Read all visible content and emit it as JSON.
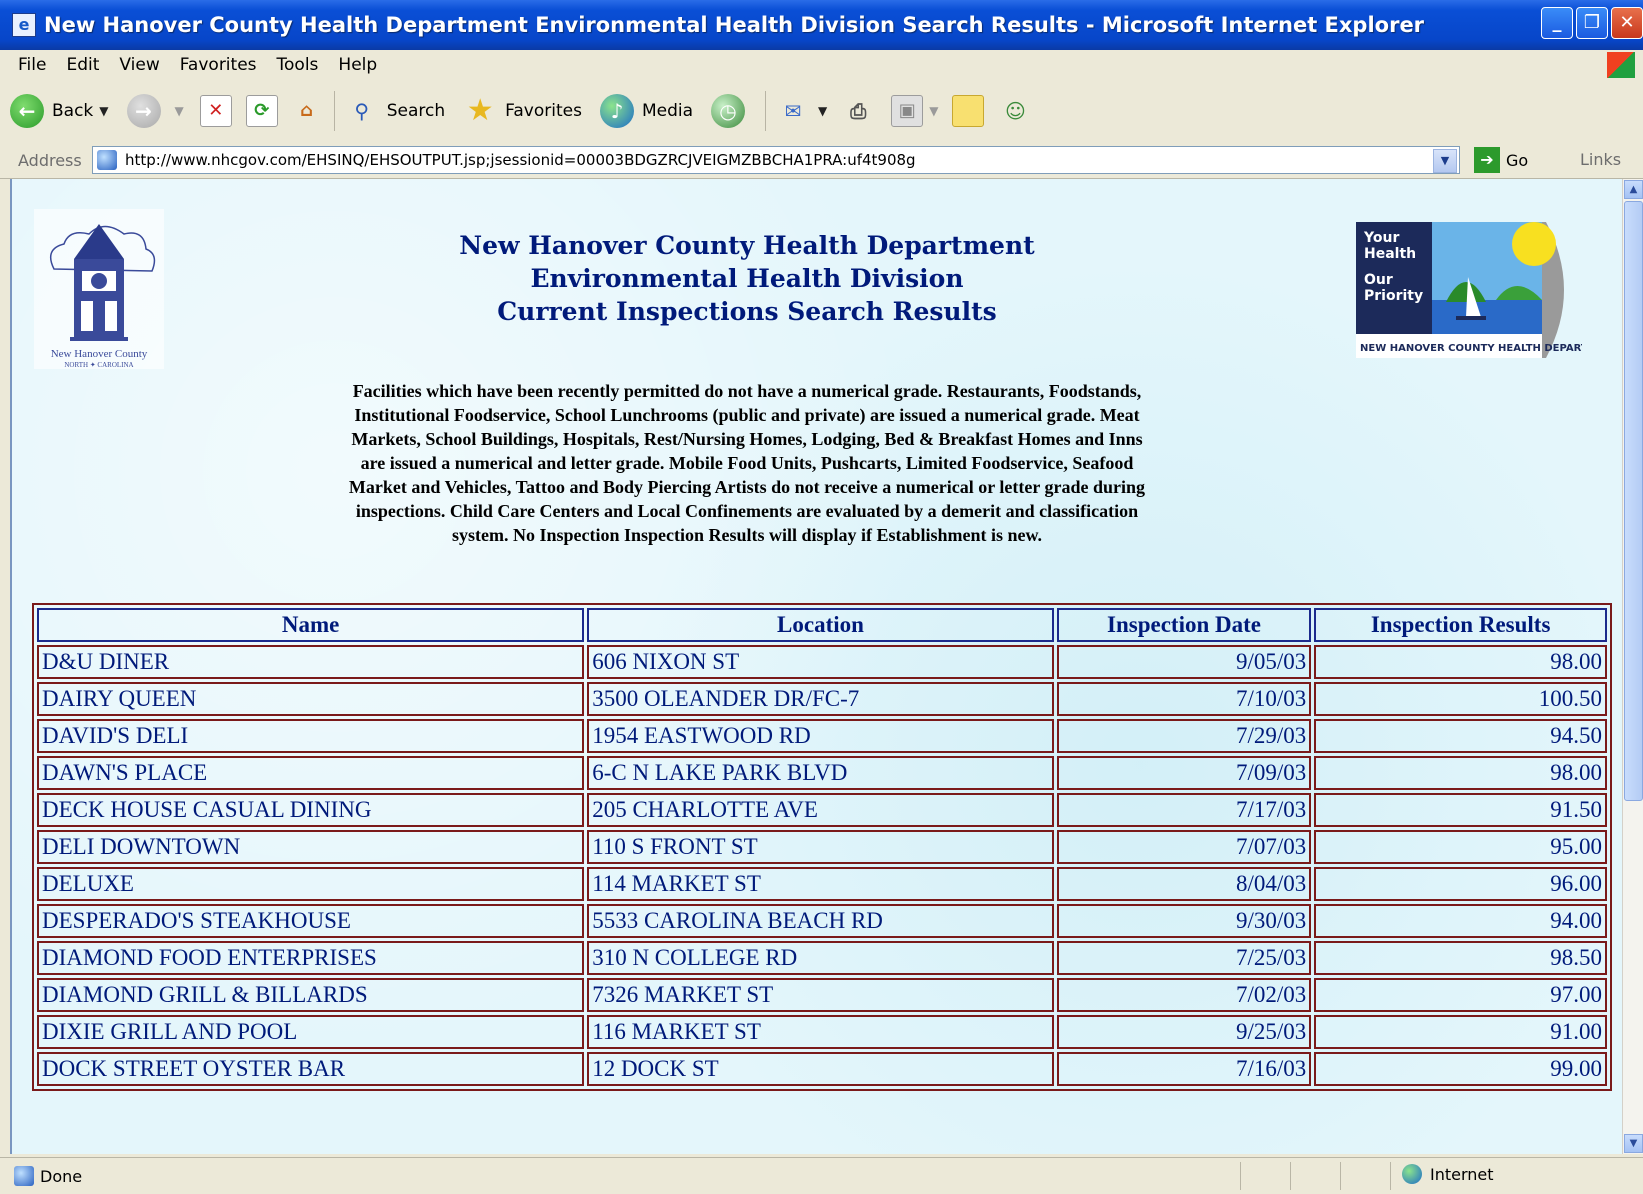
{
  "window": {
    "title": "New Hanover County Health Department Environmental Health Division Search Results - Microsoft Internet Explorer",
    "minimize": "_",
    "restore": "❐",
    "close": "✕"
  },
  "menu": [
    "File",
    "Edit",
    "View",
    "Favorites",
    "Tools",
    "Help"
  ],
  "toolbar": {
    "back_label": "Back",
    "search_label": "Search",
    "favorites_label": "Favorites",
    "media_label": "Media"
  },
  "address": {
    "label": "Address",
    "url": "http://www.nhcgov.com/EHSINQ/EHSOUTPUT.jsp;jsessionid=00003BDGZRCJVEIGMZBBCHA1PRA:uf4t908g",
    "go_label": "Go",
    "links_label": "Links"
  },
  "page": {
    "heading_line1": "New Hanover County Health Department",
    "heading_line2": "Environmental Health Division",
    "heading_line3": "Current Inspections Search Results",
    "notice": "Facilities which have been recently permitted do not have a numerical grade. Restaurants, Foodstands, Institutional Foodservice, School Lunchrooms (public and private) are issued a numerical grade. Meat Markets, School Buildings, Hospitals, Rest/Nursing Homes, Lodging, Bed & Breakfast Homes and Inns are issued a numerical and letter grade. Mobile Food Units, Pushcarts, Limited Foodservice, Seafood Market and Vehicles, Tattoo and Body Piercing Artists do not receive a numerical or letter grade during inspections. Child Care Centers and Local Confinements are evaluated by a demerit and classification system. No Inspection Inspection Results will display if Establishment is new.",
    "logo_left_caption": "New Hanover County",
    "logo_left_subcaption": "NORTH ✦ CAROLINA",
    "logo_right_line1": "Your",
    "logo_right_line2": "Health",
    "logo_right_line3": "Our",
    "logo_right_line4": "Priority",
    "logo_right_ring": "NEW HANOVER COUNTY HEALTH DEPARTMENT"
  },
  "table": {
    "headers": [
      "Name",
      "Location",
      "Inspection Date",
      "Inspection Results"
    ],
    "rows": [
      [
        "D&U DINER",
        "606 NIXON ST",
        "9/05/03",
        "98.00"
      ],
      [
        "DAIRY QUEEN",
        "3500 OLEANDER DR/FC-7",
        "7/10/03",
        "100.50"
      ],
      [
        "DAVID'S DELI",
        "1954 EASTWOOD RD",
        "7/29/03",
        "94.50"
      ],
      [
        "DAWN'S PLACE",
        "6-C N LAKE PARK BLVD",
        "7/09/03",
        "98.00"
      ],
      [
        "DECK HOUSE CASUAL DINING",
        "205 CHARLOTTE AVE",
        "7/17/03",
        "91.50"
      ],
      [
        "DELI DOWNTOWN",
        "110 S FRONT ST",
        "7/07/03",
        "95.00"
      ],
      [
        "DELUXE",
        "114 MARKET ST",
        "8/04/03",
        "96.00"
      ],
      [
        "DESPERADO'S STEAKHOUSE",
        "5533 CAROLINA BEACH RD",
        "9/30/03",
        "94.00"
      ],
      [
        "DIAMOND FOOD ENTERPRISES",
        "310 N COLLEGE RD",
        "7/25/03",
        "98.50"
      ],
      [
        "DIAMOND GRILL & BILLARDS",
        "7326 MARKET ST",
        "7/02/03",
        "97.00"
      ],
      [
        "DIXIE GRILL AND POOL",
        "116 MARKET ST",
        "9/25/03",
        "91.00"
      ],
      [
        "DOCK STREET OYSTER BAR",
        "12 DOCK ST",
        "7/16/03",
        "99.00"
      ]
    ]
  },
  "status": {
    "text": "Done",
    "zone": "Internet"
  },
  "colors": {
    "heading": "#001a7a",
    "table_border": "#7a1a1a",
    "page_bg": "#e4f6fb"
  }
}
